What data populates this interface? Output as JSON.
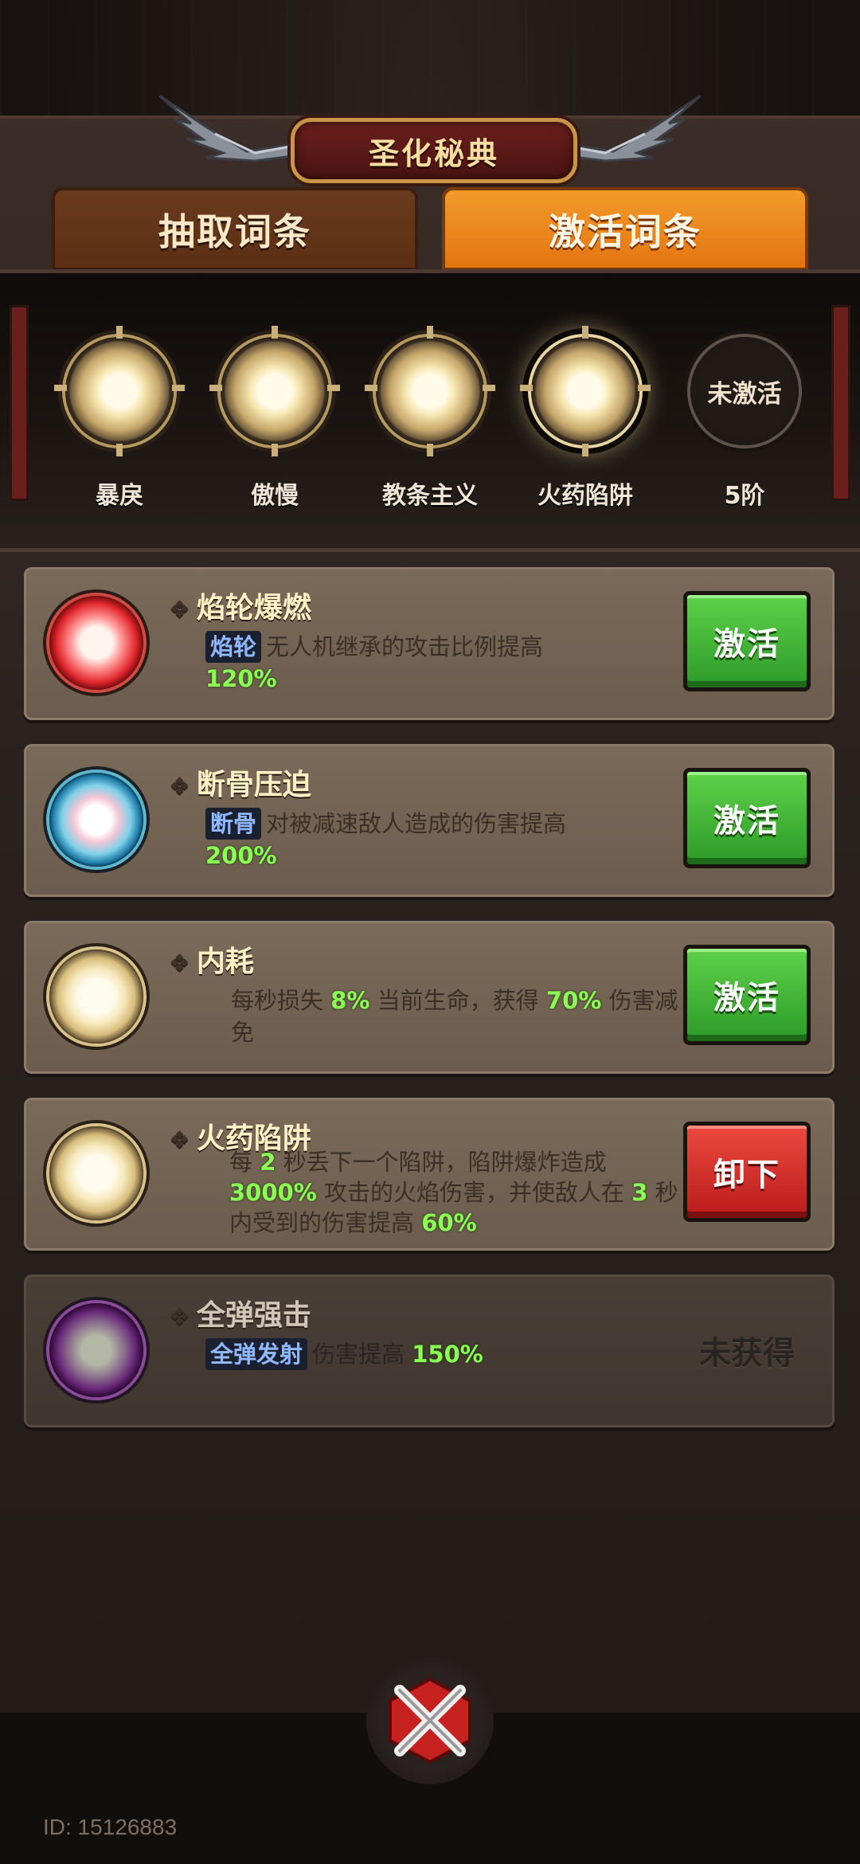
{
  "header": {
    "title": "圣化秘典"
  },
  "tabs": [
    {
      "label": "抽取词条",
      "active": false
    },
    {
      "label": "激活词条",
      "active": true
    }
  ],
  "slots": [
    {
      "label": "暴戾",
      "state": "filled"
    },
    {
      "label": "傲慢",
      "state": "filled"
    },
    {
      "label": "教条主义",
      "state": "filled"
    },
    {
      "label": "火药陷阱",
      "state": "selected"
    },
    {
      "label": "5阶",
      "state": "empty",
      "empty_text": "未激活"
    }
  ],
  "cards": [
    {
      "name": "焰轮爆燃",
      "orb": "red",
      "tag": "焰轮",
      "desc_before": "无人机继承的攻击比例提高",
      "value": "120%",
      "button": "激活",
      "button_color": "#2c9a28"
    },
    {
      "name": "断骨压迫",
      "orb": "blue",
      "tag": "断骨",
      "desc_before": "对被减速敌人造成的伤害提高",
      "value": "200%",
      "button": "激活",
      "button_color": "#2c9a28"
    },
    {
      "name": "内耗",
      "orb": "gold",
      "desc_parts": [
        "每秒损失 ",
        "8%",
        " 当前生命，获得 ",
        "70%",
        " 伤害减免"
      ],
      "button": "激活",
      "button_color": "#2c9a28"
    },
    {
      "name": "火药陷阱",
      "orb": "gold",
      "desc_parts": [
        "每 ",
        "2",
        " 秒丢下一个陷阱，陷阱爆炸造成 ",
        "3000%",
        " 攻击的火焰伤害，并使敌人在 ",
        "3",
        " 秒内受到的伤害提高 ",
        "60%"
      ],
      "button": "卸下",
      "button_color": "#b91b1b"
    },
    {
      "name": "全弹强击",
      "orb": "purple",
      "tag": "全弹发射",
      "desc_before": "伤害提高",
      "value": "150%",
      "status": "未获得"
    }
  ],
  "footer": {
    "id_text": "ID: 15126883"
  },
  "icons": {
    "close": "close-x-icon",
    "wing": "wing-icon",
    "bullet": "diamond-bullet-icon"
  }
}
